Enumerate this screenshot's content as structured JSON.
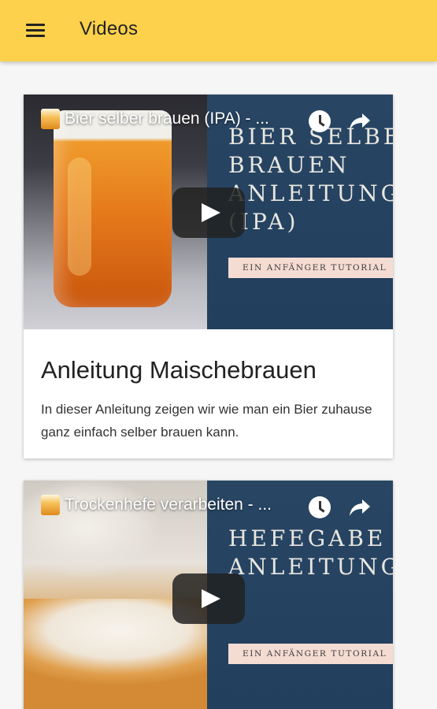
{
  "appbar": {
    "title": "Videos",
    "menu_icon": "hamburger-menu-icon",
    "color": "#fdd14b"
  },
  "videos": [
    {
      "video_title": "Bier selber brauen (IPA) - ...",
      "thumbnail_lines": [
        "BIER SELBER",
        "BRAUEN",
        "ANLEITUNG",
        "(IPA)"
      ],
      "ribbon": "EIN ANFÄNGER TUTORIAL",
      "card_title": "Anleitung Maischebrauen",
      "card_text": "In dieser Anleitung zeigen wir wie man ein Bier zuhause ganz einfach selber brauen kann."
    },
    {
      "video_title": "Trockenhefe verarbeiten - ...",
      "thumbnail_lines": [
        "HEFEGABE",
        "ANLEITUNG"
      ],
      "ribbon": "EIN ANFÄNGER TUTORIAL"
    }
  ],
  "icons": {
    "watch_later": "clock-icon",
    "share": "share-icon",
    "play": "play-icon",
    "channel": "beer-icon"
  },
  "colors": {
    "thumbnail_panel": "#223f5d",
    "ribbon": "#f5dcd3"
  }
}
